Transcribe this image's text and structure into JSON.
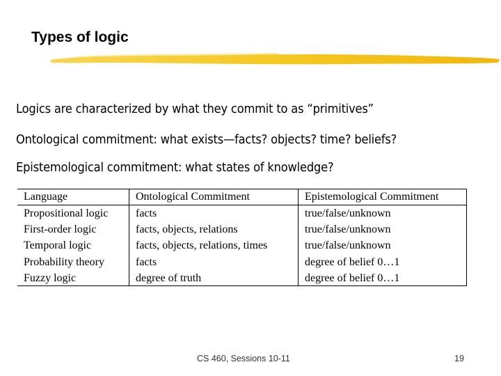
{
  "slide": {
    "title": "Types of logic",
    "bullets": [
      "Logics are characterized by what they commit to as “primitives”",
      "Ontological commitment: what exists—facts? objects? time? beliefs?",
      "Epistemological commitment: what states of knowledge?"
    ],
    "accent_color": "#f5c518"
  },
  "table": {
    "headers": [
      "Language",
      "Ontological Commitment",
      "Epistemological Commitment"
    ],
    "rows": [
      [
        "Propositional logic",
        "facts",
        "true/false/unknown"
      ],
      [
        "First-order logic",
        "facts, objects, relations",
        "true/false/unknown"
      ],
      [
        "Temporal logic",
        "facts, objects, relations, times",
        "true/false/unknown"
      ],
      [
        "Probability theory",
        "facts",
        "degree of belief 0…1"
      ],
      [
        "Fuzzy logic",
        "degree of truth",
        "degree of belief 0…1"
      ]
    ]
  },
  "footer": {
    "course": "CS 460,  Sessions 10-11",
    "page_number": "19"
  }
}
